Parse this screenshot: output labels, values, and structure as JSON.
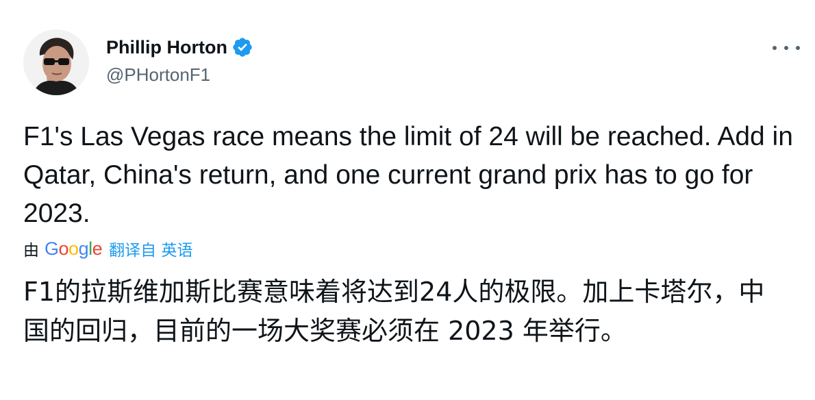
{
  "author": {
    "display_name": "Phillip Horton",
    "handle": "@PHortonF1",
    "verified": true,
    "verified_color": "#1d9bf0"
  },
  "tweet": {
    "text": "F1's Las Vegas race means the limit of 24 will be reached. Add in Qatar, China's return, and one current grand prix has to go for 2023.",
    "translation": {
      "by_label": "由",
      "provider": [
        "G",
        "o",
        "o",
        "g",
        "l",
        "e"
      ],
      "link_label": "翻译自 英语",
      "text": "F1的拉斯维加斯比赛意味着将达到24人的极限。加上卡塔尔，中国的回归，目前的一场大奖赛必须在 2023 年举行。"
    }
  },
  "icons": {
    "more": "more-horizontal-icon",
    "verified": "verified-badge-icon"
  },
  "colors": {
    "text": "#0f1419",
    "secondary_text": "#536471",
    "link": "#1d9bf0"
  }
}
